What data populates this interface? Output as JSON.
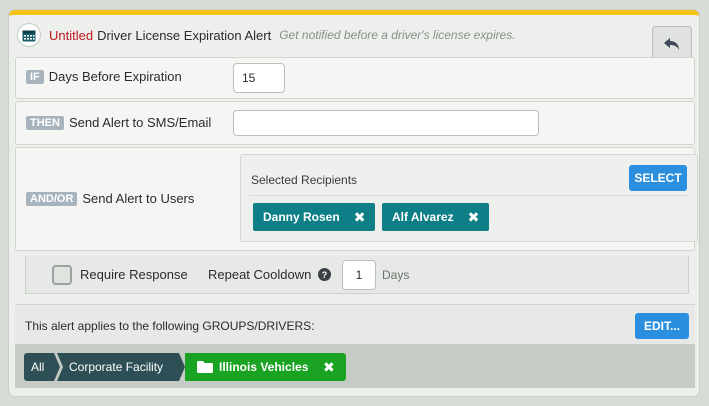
{
  "header": {
    "untitled": "Untitled",
    "title": "Driver License Expiration Alert",
    "description": "Get notified before a driver's license expires.",
    "icon": "calendar-icon"
  },
  "if_row": {
    "badge": "IF",
    "label": "Days Before Expiration",
    "value": "15"
  },
  "then_row": {
    "badge": "THEN",
    "label": "Send Alert to SMS/Email",
    "value": ""
  },
  "andor_row": {
    "badge": "AND/OR",
    "label": "Send Alert to Users",
    "selected_label": "Selected Recipients",
    "select_button": "SELECT",
    "recipients": [
      "Danny Rosen",
      "Alf Alvarez"
    ]
  },
  "options": {
    "require_response": "Require Response",
    "repeat_cooldown": "Repeat Cooldown",
    "cooldown_value": "1",
    "cooldown_unit": "Days",
    "require_checked": false
  },
  "applies": {
    "label": "This alert applies to the following GROUPS/DRIVERS:",
    "edit_button": "EDIT...",
    "breadcrumb": [
      "All",
      "Corporate Facility"
    ],
    "selected_group": "Illinois Vehicles"
  },
  "colors": {
    "accent_yellow": "#f3c417",
    "button_blue": "#2a8fde",
    "chip_teal": "#0e7f86",
    "group_green": "#1aa323",
    "untitled_red": "#c0181f"
  }
}
